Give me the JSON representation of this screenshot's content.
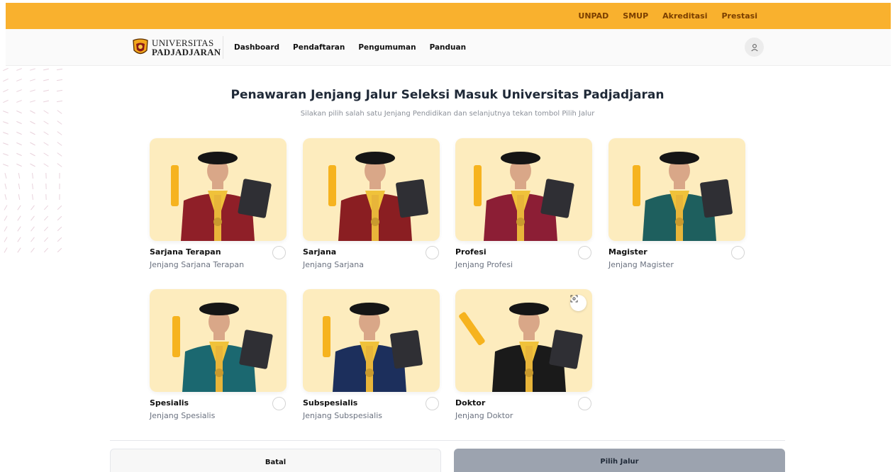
{
  "topbar": {
    "links": [
      "UNPAD",
      "SMUP",
      "Akreditasi",
      "Prestasi"
    ]
  },
  "navbar": {
    "logo_line1": "UNIVERSITAS",
    "logo_line2": "PADJADJARAN",
    "menu": [
      "Dashboard",
      "Pendaftaran",
      "Pengumuman",
      "Panduan"
    ],
    "user_icon": "user-icon"
  },
  "main": {
    "title": "Penawaran Jenjang Jalur Seleksi Masuk Universitas Padjadjaran",
    "subtitle": "Silakan pilih salah satu Jenjang Pendidikan dan selanjutnya tekan tombol Pilih Jalur"
  },
  "programs": [
    {
      "title": "Sarjana Terapan",
      "subtitle": "Jenjang Sarjana Terapan",
      "gown": "#8f1f28",
      "selected": false
    },
    {
      "title": "Sarjana",
      "subtitle": "Jenjang Sarjana",
      "gown": "#8a1e22",
      "selected": false
    },
    {
      "title": "Profesi",
      "subtitle": "Jenjang Profesi",
      "gown": "#8c1e35",
      "selected": false
    },
    {
      "title": "Magister",
      "subtitle": "Jenjang Magister",
      "gown": "#1e5f5e",
      "selected": false
    },
    {
      "title": "Spesialis",
      "subtitle": "Jenjang Spesialis",
      "gown": "#1b6870",
      "selected": false
    },
    {
      "title": "Subspesialis",
      "subtitle": "Jenjang Subspesialis",
      "gown": "#1c2f5c",
      "selected": false
    },
    {
      "title": "Doktor",
      "subtitle": "Jenjang Doktor",
      "gown": "#1a1a1a",
      "selected": false
    }
  ],
  "actions": {
    "cancel": "Batal",
    "submit": "Pilih Jalur"
  },
  "colors": {
    "accent": "#f9b12e",
    "card_bg": "#fdecbe",
    "submit_disabled": "#9ca3af"
  }
}
